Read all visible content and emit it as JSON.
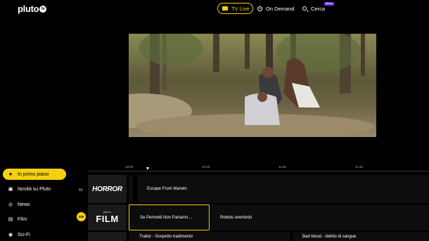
{
  "brand": {
    "logo_text": "pluto",
    "logo_badge": "tv"
  },
  "nav": {
    "live_label": "TV Live",
    "on_demand_label": "On Demand",
    "search_label": "Cerca",
    "new_badge": "Nuovo"
  },
  "timeline": {
    "times": [
      "10:00",
      "10:30",
      "11:00",
      "11:30"
    ]
  },
  "sidebar": {
    "items": [
      {
        "label": "In primo piano",
        "icon": "star-icon"
      },
      {
        "label": "Novità su Pluto",
        "icon": "tv-icon"
      },
      {
        "label": "News",
        "icon": "globe-icon"
      },
      {
        "label": "Film",
        "icon": "film-icon"
      },
      {
        "label": "Sci-Fi",
        "icon": "alien-icon"
      }
    ]
  },
  "guide": {
    "rows": [
      {
        "channel_number": "50",
        "channel_logo": "HORROR",
        "programs": [
          "Escape From Marwin"
        ]
      },
      {
        "channel_number": "200",
        "channel_logo_small": "pluto tv",
        "channel_logo": "FILM",
        "programs": [
          "Se Permetti Non Parlarmi ...",
          "Robots overlords"
        ]
      },
      {
        "programs": [
          "Traitor - Sospetto tradimento",
          "Bad blood - debito di sangue"
        ]
      }
    ]
  },
  "colors": {
    "accent": "#f5d00f",
    "background": "#000000",
    "new_badge": "#7b2ff7"
  }
}
